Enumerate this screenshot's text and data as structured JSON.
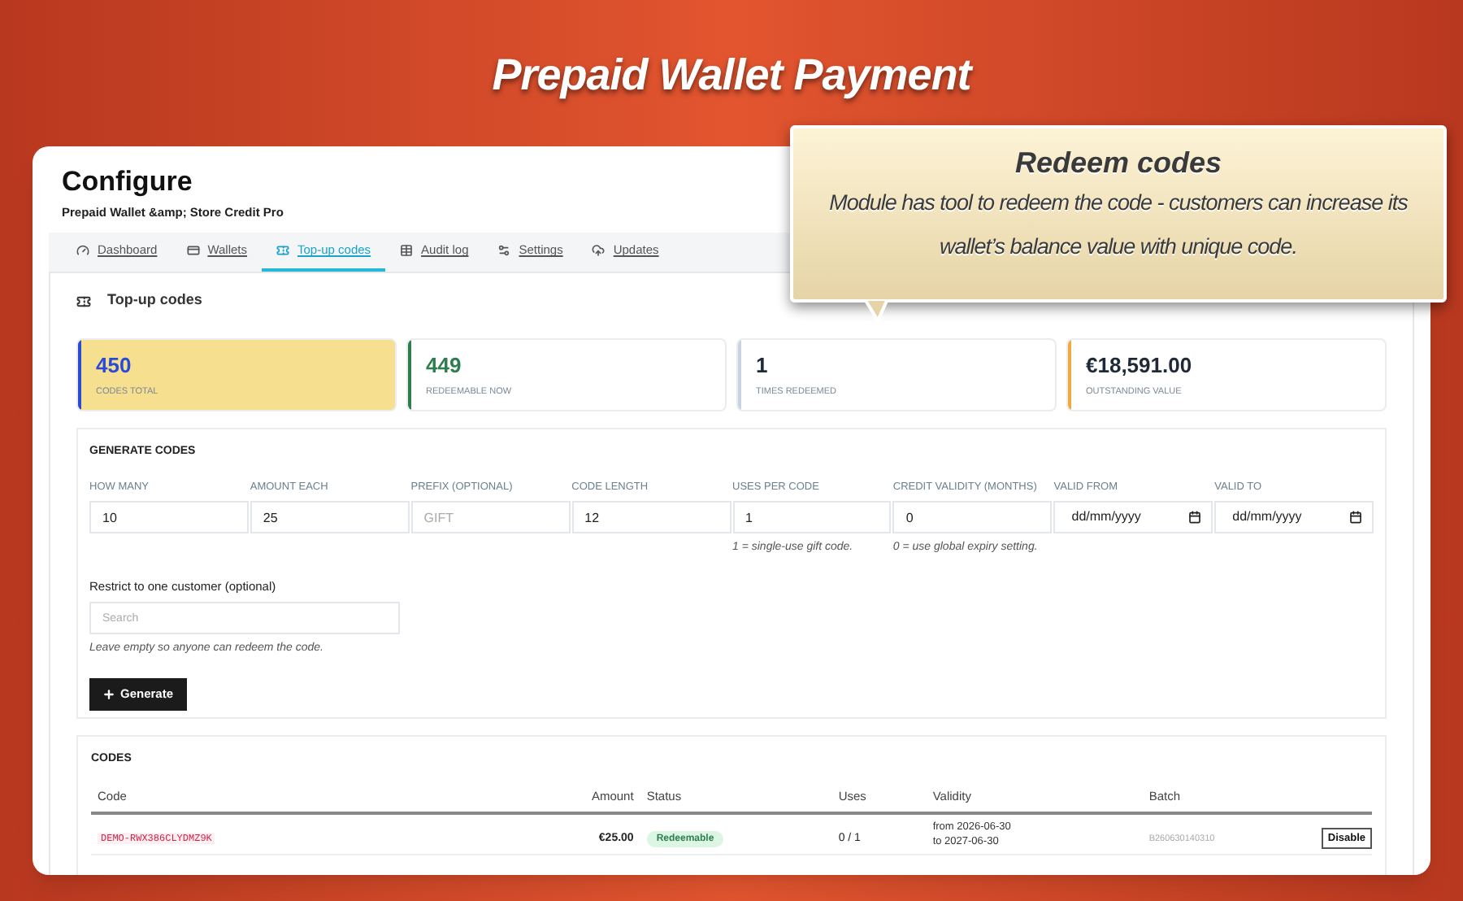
{
  "banner_title": "Prepaid Wallet Payment",
  "callout": {
    "title": "Redeem codes",
    "text": "Module has tool to redeem the code - customers can increase its wallet’s balance value with unique code."
  },
  "page": {
    "title": "Configure",
    "subtitle": "Prepaid Wallet &amp; Store Credit Pro"
  },
  "tabs": [
    {
      "label": "Dashboard",
      "selected": false
    },
    {
      "label": "Wallets",
      "selected": false
    },
    {
      "label": "Top-up codes",
      "selected": true
    },
    {
      "label": "Audit log",
      "selected": false
    },
    {
      "label": "Settings",
      "selected": false
    },
    {
      "label": "Updates",
      "selected": false
    }
  ],
  "section_title": "Top-up codes",
  "stats": [
    {
      "value": "450",
      "label": "CODES TOTAL",
      "color": "#2a4bd7",
      "kind": "accent",
      "selected": true
    },
    {
      "value": "449",
      "label": "REDEEMABLE NOW",
      "color": "#2e7d4f",
      "kind": "accent",
      "selected": false
    },
    {
      "value": "1",
      "label": "TIMES REDEEMED",
      "color": "#c9d3e0",
      "kind": "plain",
      "selected": false
    },
    {
      "value": "€18,591.00",
      "label": "OUTSTANDING VALUE",
      "color": "#f0a93b",
      "kind": "plain",
      "selected": false
    }
  ],
  "generate": {
    "title": "GENERATE CODES",
    "fields": [
      {
        "kind": "input",
        "label": "HOW MANY",
        "value": "10"
      },
      {
        "kind": "input",
        "label": "AMOUNT EACH",
        "value": "25"
      },
      {
        "kind": "input",
        "label": "PREFIX (OPTIONAL)",
        "placeholder": "GIFT"
      },
      {
        "kind": "input",
        "label": "CODE LENGTH",
        "value": "12"
      },
      {
        "kind": "input",
        "label": "USES PER CODE",
        "value": "1",
        "hint": "1 = single-use gift code."
      },
      {
        "kind": "input",
        "label": "CREDIT VALIDITY (MONTHS)",
        "value": "0",
        "hint": "0 = use global expiry setting."
      },
      {
        "kind": "date",
        "label": "VALID FROM",
        "placeholder": "dd/mm/yyyy"
      },
      {
        "kind": "date",
        "label": "VALID TO",
        "placeholder": "dd/mm/yyyy"
      }
    ],
    "customer": {
      "label": "Restrict to one customer (optional)",
      "placeholder": "Search",
      "hint": "Leave empty so anyone can redeem the code."
    },
    "button": "Generate"
  },
  "codes": {
    "title": "CODES",
    "columns": [
      "Code",
      "Amount",
      "Status",
      "Uses",
      "Validity",
      "Batch"
    ],
    "rows": [
      {
        "code": "DEMO-RWX386CLYDMZ9K",
        "amount": "€25.00",
        "status": "Redeemable",
        "uses": "0 / 1",
        "validity_from": "from 2026-06-30",
        "validity_to": "to 2027-06-30",
        "batch": "B260630140310",
        "action": "Disable"
      }
    ]
  }
}
